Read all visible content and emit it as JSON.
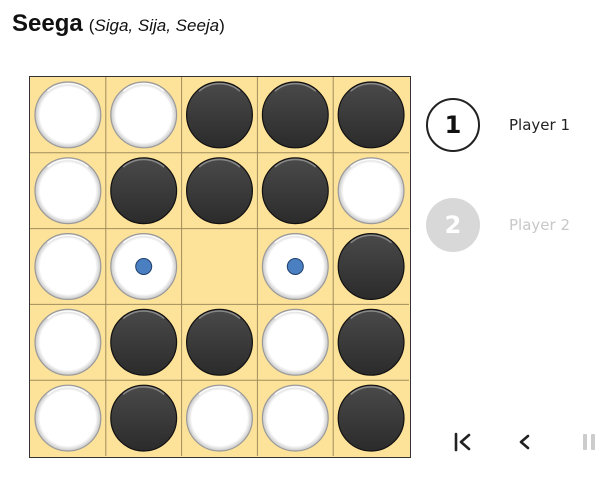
{
  "header": {
    "title": "Seega",
    "subtitle_open": "(",
    "subtitle_alt": "Siga, Sija, Seeja",
    "subtitle_close": ")"
  },
  "board": {
    "rows": 5,
    "cols": 5,
    "cells": [
      [
        "white",
        "white",
        "black",
        "black",
        "black"
      ],
      [
        "white",
        "black",
        "black",
        "black",
        "white"
      ],
      [
        "white",
        "white",
        "empty",
        "white",
        "black"
      ],
      [
        "white",
        "black",
        "black",
        "white",
        "black"
      ],
      [
        "white",
        "black",
        "white",
        "white",
        "black"
      ]
    ],
    "marked_cells": [
      [
        2,
        1
      ],
      [
        2,
        3
      ]
    ],
    "colors": {
      "board": "#fde299",
      "grid": "#a08d5d",
      "white_piece": "#ffffff",
      "black_piece": "#2b2b2b",
      "marker": "#4a7fc1"
    }
  },
  "players": [
    {
      "number": "1",
      "name": "Player 1",
      "state": "active"
    },
    {
      "number": "2",
      "name": "Player 2",
      "state": "inactive"
    }
  ],
  "controls": [
    {
      "name": "first-move-button",
      "icon": "skip-to-start-icon",
      "state": "enabled"
    },
    {
      "name": "previous-move-button",
      "icon": "chevron-left-icon",
      "state": "enabled"
    },
    {
      "name": "pause-button",
      "icon": "pause-icon",
      "state": "disabled"
    }
  ]
}
